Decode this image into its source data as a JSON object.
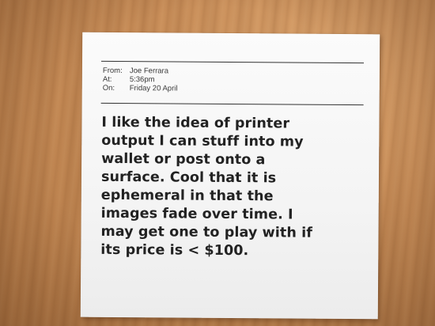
{
  "receipt": {
    "header": [
      {
        "label": "From:",
        "value": "Joe Ferrara"
      },
      {
        "label": "At:",
        "value": "5:36pm"
      },
      {
        "label": "On:",
        "value": "Friday 20 April"
      }
    ],
    "message_lines": [
      "I like the idea of printer",
      "output I can stuff into my",
      "wallet or post onto a",
      "surface. Cool that it is",
      "ephemeral in that the",
      "images fade over time. I",
      "may get one to play with if",
      "its price is < $100."
    ]
  },
  "colors": {
    "desk": "#c88d58",
    "paper": "#f7f7f7",
    "ink": "#222222"
  }
}
